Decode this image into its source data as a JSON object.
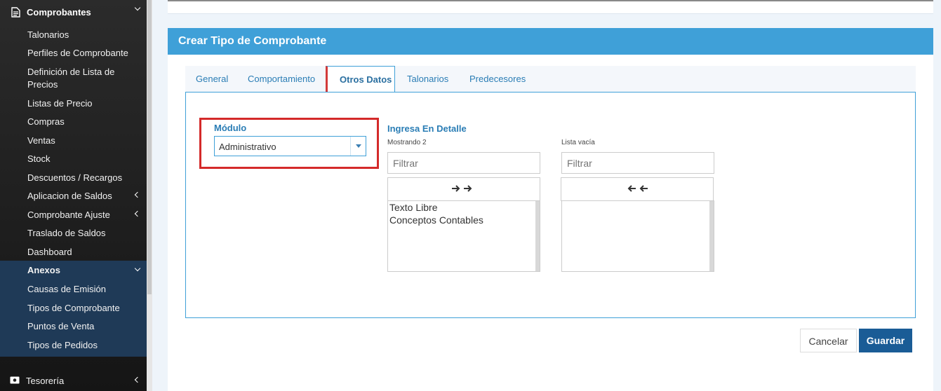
{
  "sidebar": {
    "section_title": "Comprobantes",
    "items": [
      {
        "label": "Talonarios"
      },
      {
        "label": "Perfiles de Comprobante"
      },
      {
        "label": "Definición de Lista de Precios"
      },
      {
        "label": "Listas de Precio"
      },
      {
        "label": "Compras"
      },
      {
        "label": "Ventas"
      },
      {
        "label": "Stock"
      },
      {
        "label": "Descuentos / Recargos"
      },
      {
        "label": "Aplicacion de Saldos"
      },
      {
        "label": "Comprobante Ajuste"
      },
      {
        "label": "Traslado de Saldos"
      },
      {
        "label": "Dashboard"
      }
    ],
    "anexos": {
      "title": "Anexos",
      "items": [
        {
          "label": "Causas de Emisión"
        },
        {
          "label": "Tipos de Comprobante"
        },
        {
          "label": "Puntos de Venta"
        },
        {
          "label": "Tipos de Pedidos"
        }
      ]
    },
    "tesoreria": {
      "label": "Tesorería"
    }
  },
  "card": {
    "title": "Crear Tipo de Comprobante",
    "tabs": [
      {
        "label": "General"
      },
      {
        "label": "Comportamiento"
      },
      {
        "label": "Otros Datos"
      },
      {
        "label": "Talonarios"
      },
      {
        "label": "Predecesores"
      }
    ],
    "active_tab": "Otros Datos",
    "modulo": {
      "label": "Módulo",
      "value": "Administrativo"
    },
    "dual_list": {
      "title": "Ingresa En Detalle",
      "left": {
        "info": "Mostrando 2",
        "filter_placeholder": "Filtrar",
        "options": [
          "Texto Libre",
          "Conceptos Contables"
        ]
      },
      "right": {
        "info": "Lista vacía",
        "filter_placeholder": "Filtrar",
        "options": []
      }
    },
    "buttons": {
      "cancel": "Cancelar",
      "save": "Guardar"
    }
  },
  "colors": {
    "accent": "#3fa0d8",
    "highlight": "#d42a2a",
    "primary_button": "#1a5c96"
  }
}
